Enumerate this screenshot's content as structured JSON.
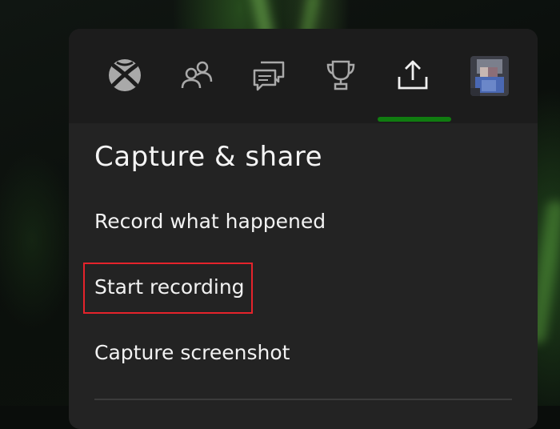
{
  "nav": {
    "tabs": [
      {
        "name": "xbox",
        "icon": "xbox-logo-icon"
      },
      {
        "name": "social",
        "icon": "people-icon"
      },
      {
        "name": "chat",
        "icon": "chat-bubbles-icon"
      },
      {
        "name": "achievements",
        "icon": "trophy-icon"
      },
      {
        "name": "capture",
        "icon": "share-upload-icon",
        "selected": true
      },
      {
        "name": "profile",
        "icon": "avatar"
      }
    ],
    "accent_color": "#107c10"
  },
  "section": {
    "title": "Capture & share",
    "items": [
      {
        "label": "Record what happened"
      },
      {
        "label": "Start recording",
        "highlighted": true
      },
      {
        "label": "Capture screenshot"
      }
    ]
  },
  "highlight_color": "#e5232b"
}
